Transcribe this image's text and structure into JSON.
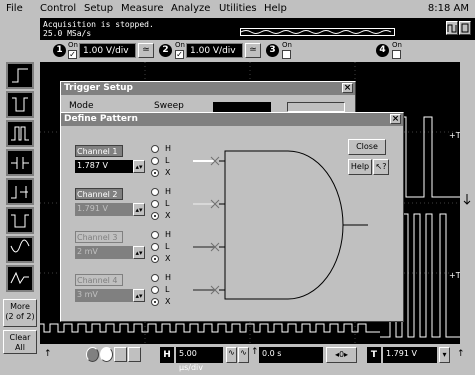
{
  "menu": {
    "items": [
      "File",
      "Control",
      "Setup",
      "Measure",
      "Analyze",
      "Utilities",
      "Help"
    ],
    "clock": "8:18 AM"
  },
  "status": {
    "line1": "Acquisition is stopped.",
    "line2": "25.0 MSa/s"
  },
  "channels_bar": {
    "ch1": {
      "num": "1",
      "on_label": "On",
      "vdiv": "1.00 V/div"
    },
    "ch2": {
      "num": "2",
      "on_label": "On",
      "vdiv": "1.00 V/div"
    },
    "ch3": {
      "num": "3",
      "on_label": "On"
    },
    "ch4": {
      "num": "4",
      "on_label": "On"
    }
  },
  "left_tools": {
    "more_label": "More\n(2 of 2)",
    "clear_label": "Clear\nAll"
  },
  "trigger_setup": {
    "title": "Trigger Setup",
    "mode_label": "Mode",
    "sweep_label": "Sweep"
  },
  "define_pattern": {
    "title": "Define Pattern",
    "close_label": "Close",
    "help_label": "Help",
    "radio_labels": [
      "H",
      "L",
      "X"
    ],
    "channels": [
      {
        "label": "Channel 1",
        "value": "1.787 V",
        "selected": "X"
      },
      {
        "label": "Channel 2",
        "value": "1.791 V",
        "selected": "X"
      },
      {
        "label": "Channel 3",
        "value": "2 mV",
        "selected": "X"
      },
      {
        "label": "Channel 4",
        "value": "3 mV",
        "selected": "X"
      }
    ]
  },
  "bottom_bar": {
    "horiz_label": "H",
    "timebase": "5.00 µs/div",
    "delay": "0.0 s",
    "trig_label": "T",
    "trig_level": "1.791 V"
  },
  "colors": {
    "display_bg": "#000000",
    "trace": "#ffffff",
    "dialog": "#c0c0c0"
  }
}
